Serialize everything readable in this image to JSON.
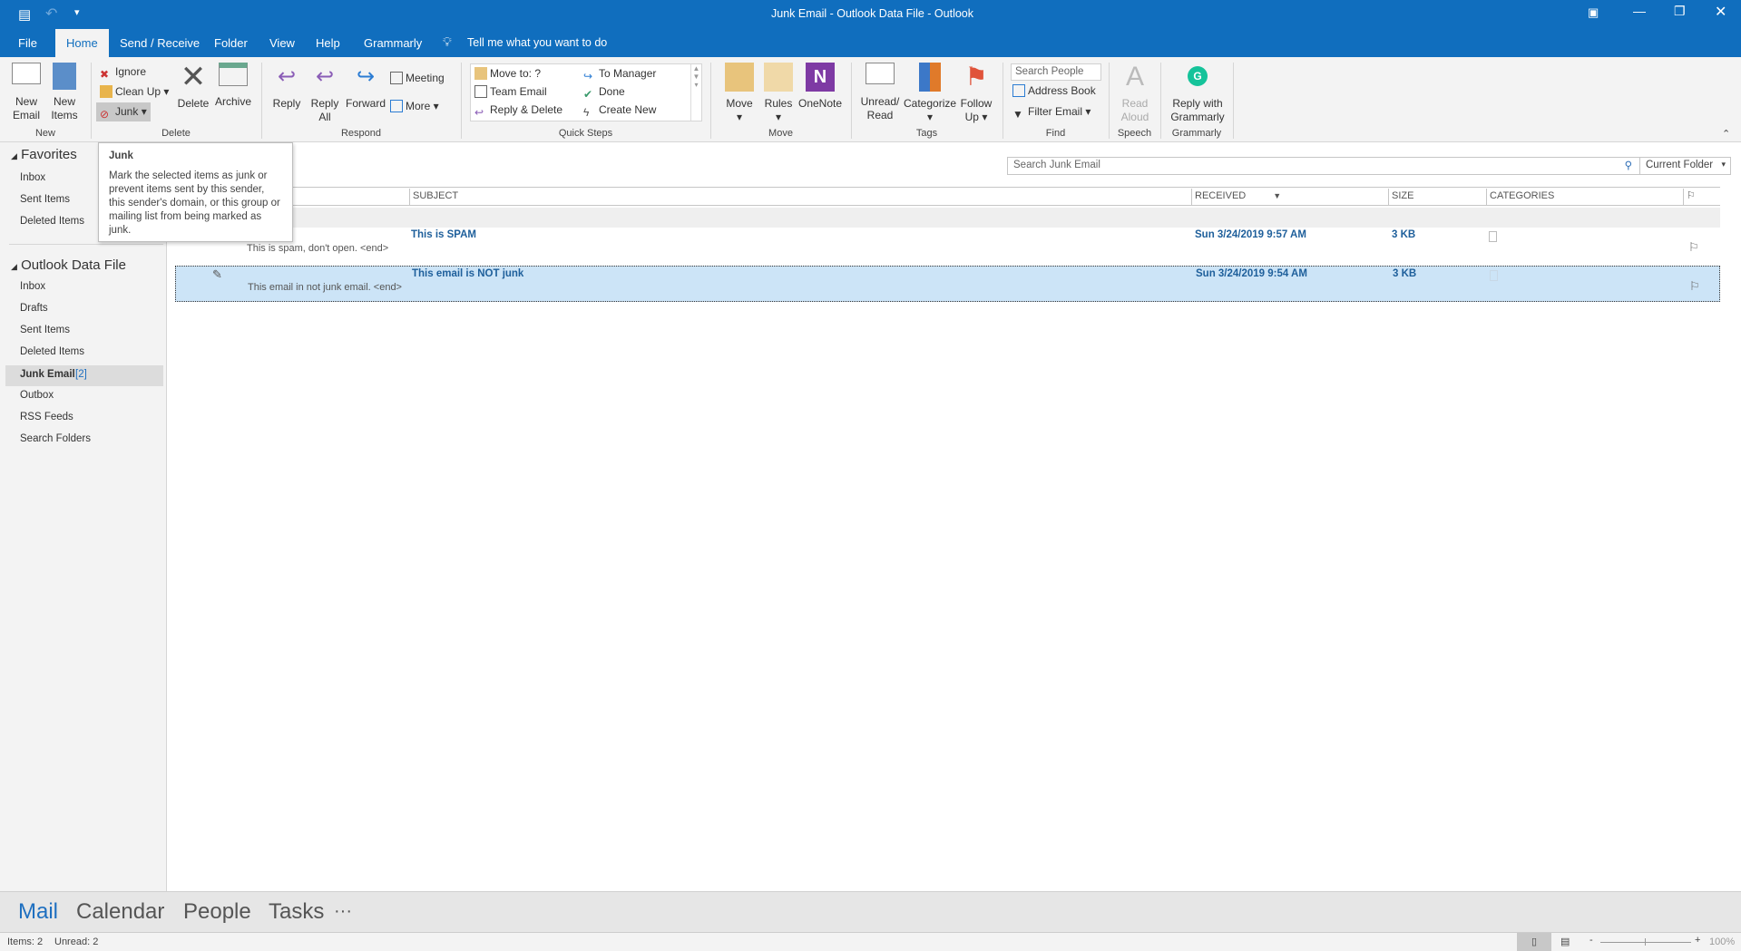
{
  "window": {
    "title": "Junk Email - Outlook Data File  -  Outlook"
  },
  "tabs": [
    {
      "label": "File"
    },
    {
      "label": "Home"
    },
    {
      "label": "Send / Receive"
    },
    {
      "label": "Folder"
    },
    {
      "label": "View"
    },
    {
      "label": "Help"
    },
    {
      "label": "Grammarly"
    }
  ],
  "tell_me": "Tell me what you want to do",
  "ribbon": {
    "new": {
      "label": "New",
      "new_email": "New Email",
      "new_items": "New Items"
    },
    "delete": {
      "label": "Delete",
      "ignore": "Ignore",
      "clean_up": "Clean Up",
      "junk": "Junk",
      "delete": "Delete",
      "archive": "Archive"
    },
    "respond": {
      "label": "Respond",
      "reply": "Reply",
      "reply_all": "Reply All",
      "forward": "Forward",
      "meeting": "Meeting",
      "more": "More"
    },
    "quick_steps": {
      "label": "Quick Steps",
      "items": [
        "Move to: ?",
        "Team Email",
        "Reply & Delete",
        "To Manager",
        "Done",
        "Create New"
      ]
    },
    "move": {
      "label": "Move",
      "move": "Move",
      "rules": "Rules",
      "onenote": "OneNote"
    },
    "tags": {
      "label": "Tags",
      "unread_read": "Unread/ Read",
      "categorize": "Categorize",
      "follow_up": "Follow Up"
    },
    "find": {
      "label": "Find",
      "search_people_placeholder": "Search People",
      "address_book": "Address Book",
      "filter_email": "Filter Email"
    },
    "speech": {
      "label": "Speech",
      "read_aloud": "Read Aloud"
    },
    "grammarly": {
      "label": "Grammarly",
      "reply_with": "Reply with Grammarly"
    }
  },
  "tooltip": {
    "title": "Junk",
    "body": "Mark the selected items as junk or prevent items sent by this sender, this sender's domain, or this group or mailing list from being marked as junk."
  },
  "folders": {
    "favorites": {
      "label": "Favorites",
      "items": [
        "Inbox",
        "Sent Items",
        "Deleted Items"
      ]
    },
    "data_file": {
      "label": "Outlook Data File",
      "items": [
        "Inbox",
        "Drafts",
        "Sent Items",
        "Deleted Items",
        "Junk Email",
        "Outbox",
        "RSS Feeds",
        "Search Folders"
      ],
      "junk_count": "[2]"
    }
  },
  "search": {
    "placeholder": "Search Junk Email",
    "scope": "Current Folder"
  },
  "columns": {
    "subject": "SUBJECT",
    "received": "RECEIVED",
    "size": "SIZE",
    "categories": "CATEGORIES"
  },
  "messages": [
    {
      "subject": "This is SPAM",
      "preview": "This is spam, don't open. <end>",
      "received": "Sun 3/24/2019 9:57 AM",
      "size": "3 KB",
      "selected": false
    },
    {
      "subject": "This email is NOT junk",
      "preview": "This email in not junk email. <end>",
      "received": "Sun 3/24/2019 9:54 AM",
      "size": "3 KB",
      "selected": true
    }
  ],
  "nav": {
    "mail": "Mail",
    "calendar": "Calendar",
    "people": "People",
    "tasks": "Tasks",
    "more": "···"
  },
  "status": {
    "items": "Items: 2",
    "unread": "Unread: 2",
    "zoom": "100%"
  },
  "colors": {
    "accent": "#106ebe",
    "selected_row": "#cce4f7",
    "unread_text": "#1e5f9b"
  }
}
